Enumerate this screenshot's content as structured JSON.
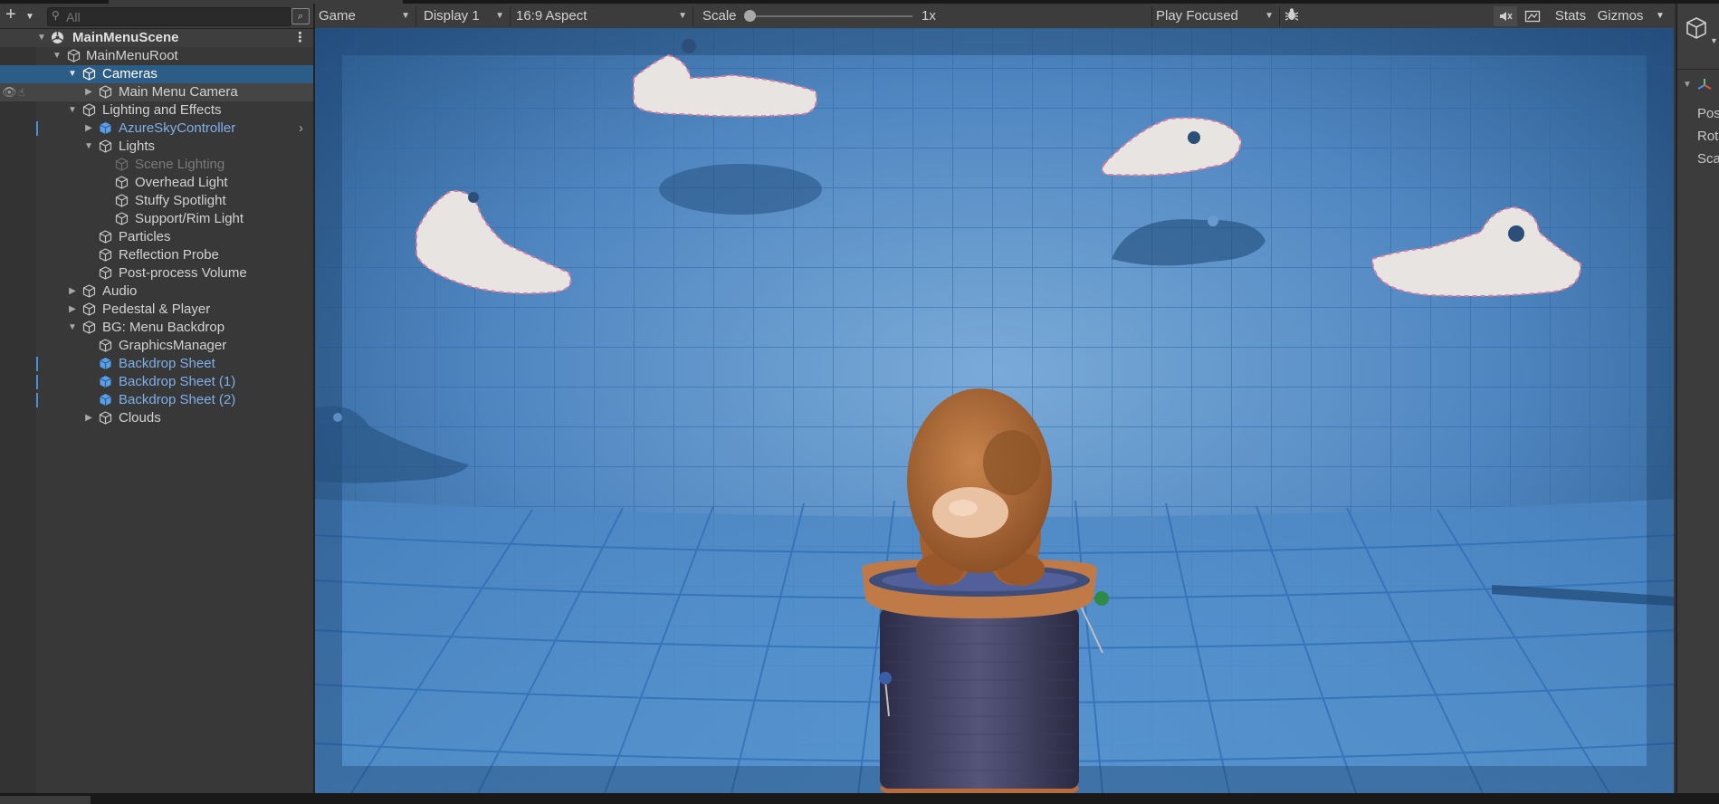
{
  "hierarchy": {
    "search_placeholder": "All",
    "add_icon": "plus-icon",
    "items": [
      {
        "label": "MainMenuScene"
      },
      {
        "label": "MainMenuRoot"
      },
      {
        "label": "Cameras"
      },
      {
        "label": "Main Menu Camera"
      },
      {
        "label": "Lighting and Effects"
      },
      {
        "label": "AzureSkyController"
      },
      {
        "label": "Lights"
      },
      {
        "label": "Scene Lighting"
      },
      {
        "label": "Overhead Light"
      },
      {
        "label": "Stuffy Spotlight"
      },
      {
        "label": "Support/Rim Light"
      },
      {
        "label": "Particles"
      },
      {
        "label": "Reflection Probe"
      },
      {
        "label": "Post-process Volume"
      },
      {
        "label": "Audio"
      },
      {
        "label": "Pedestal & Player"
      },
      {
        "label": "BG: Menu Backdrop"
      },
      {
        "label": "GraphicsManager"
      },
      {
        "label": "Backdrop Sheet"
      },
      {
        "label": "Backdrop Sheet (1)"
      },
      {
        "label": "Backdrop Sheet (2)"
      },
      {
        "label": "Clouds"
      }
    ]
  },
  "game_toolbar": {
    "view_mode": "Game",
    "display": "Display 1",
    "aspect": "16:9 Aspect",
    "scale_label": "Scale",
    "scale_value": "1x",
    "scale_fraction": 0,
    "play_mode": "Play Focused",
    "stats": "Stats",
    "gizmos": "Gizmos"
  },
  "inspector": {
    "rows": [
      "Pos",
      "Rot",
      "Sca"
    ]
  },
  "colors": {
    "selection": "#2c5d87",
    "prefab_text": "#7fb0ea",
    "backdrop_blue": "#3f7fbf"
  }
}
